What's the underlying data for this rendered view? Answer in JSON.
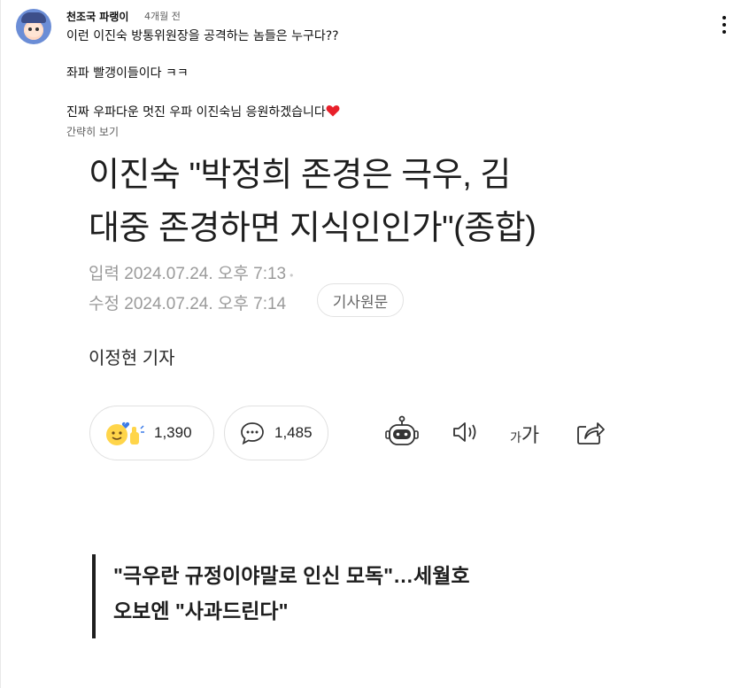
{
  "comment": {
    "author": "천조국 파랭이",
    "time": "4개월 전",
    "lines": [
      "이런 이진숙 방통위원장을 공격하는 놈들은 누구다??",
      "좌파 빨갱이들이다 ㅋㅋ",
      "진짜 우파다운 멋진 우파 이진숙님 응원하겠습니다"
    ],
    "heart_icon": "red-heart-icon",
    "read_more": "간략히 보기",
    "menu_icon": "vertical-dots-icon"
  },
  "article": {
    "headline_line1": "이진숙 \"박정희 존경은 극우, 김",
    "headline_line2": "대중 존경하면 지식인인가\"(종합)",
    "input_label": "입력",
    "input_datetime": "2024.07.24. 오후 7:13",
    "edit_label": "수정",
    "edit_datetime": "2024.07.24. 오후 7:14",
    "original_button": "기사원문",
    "reporter": "이정현 기자",
    "reaction_count": "1,390",
    "comment_count": "1,485",
    "font_small": "가",
    "font_big": "가",
    "quote_line1": "\"극우란 규정이야말로 인신 모독\"…세월호",
    "quote_line2": "오보엔 \"사과드린다\""
  },
  "colors": {
    "heart": "#e8202a",
    "quote_bar": "#1e1e1e",
    "meta_text": "#9a9a9a"
  }
}
